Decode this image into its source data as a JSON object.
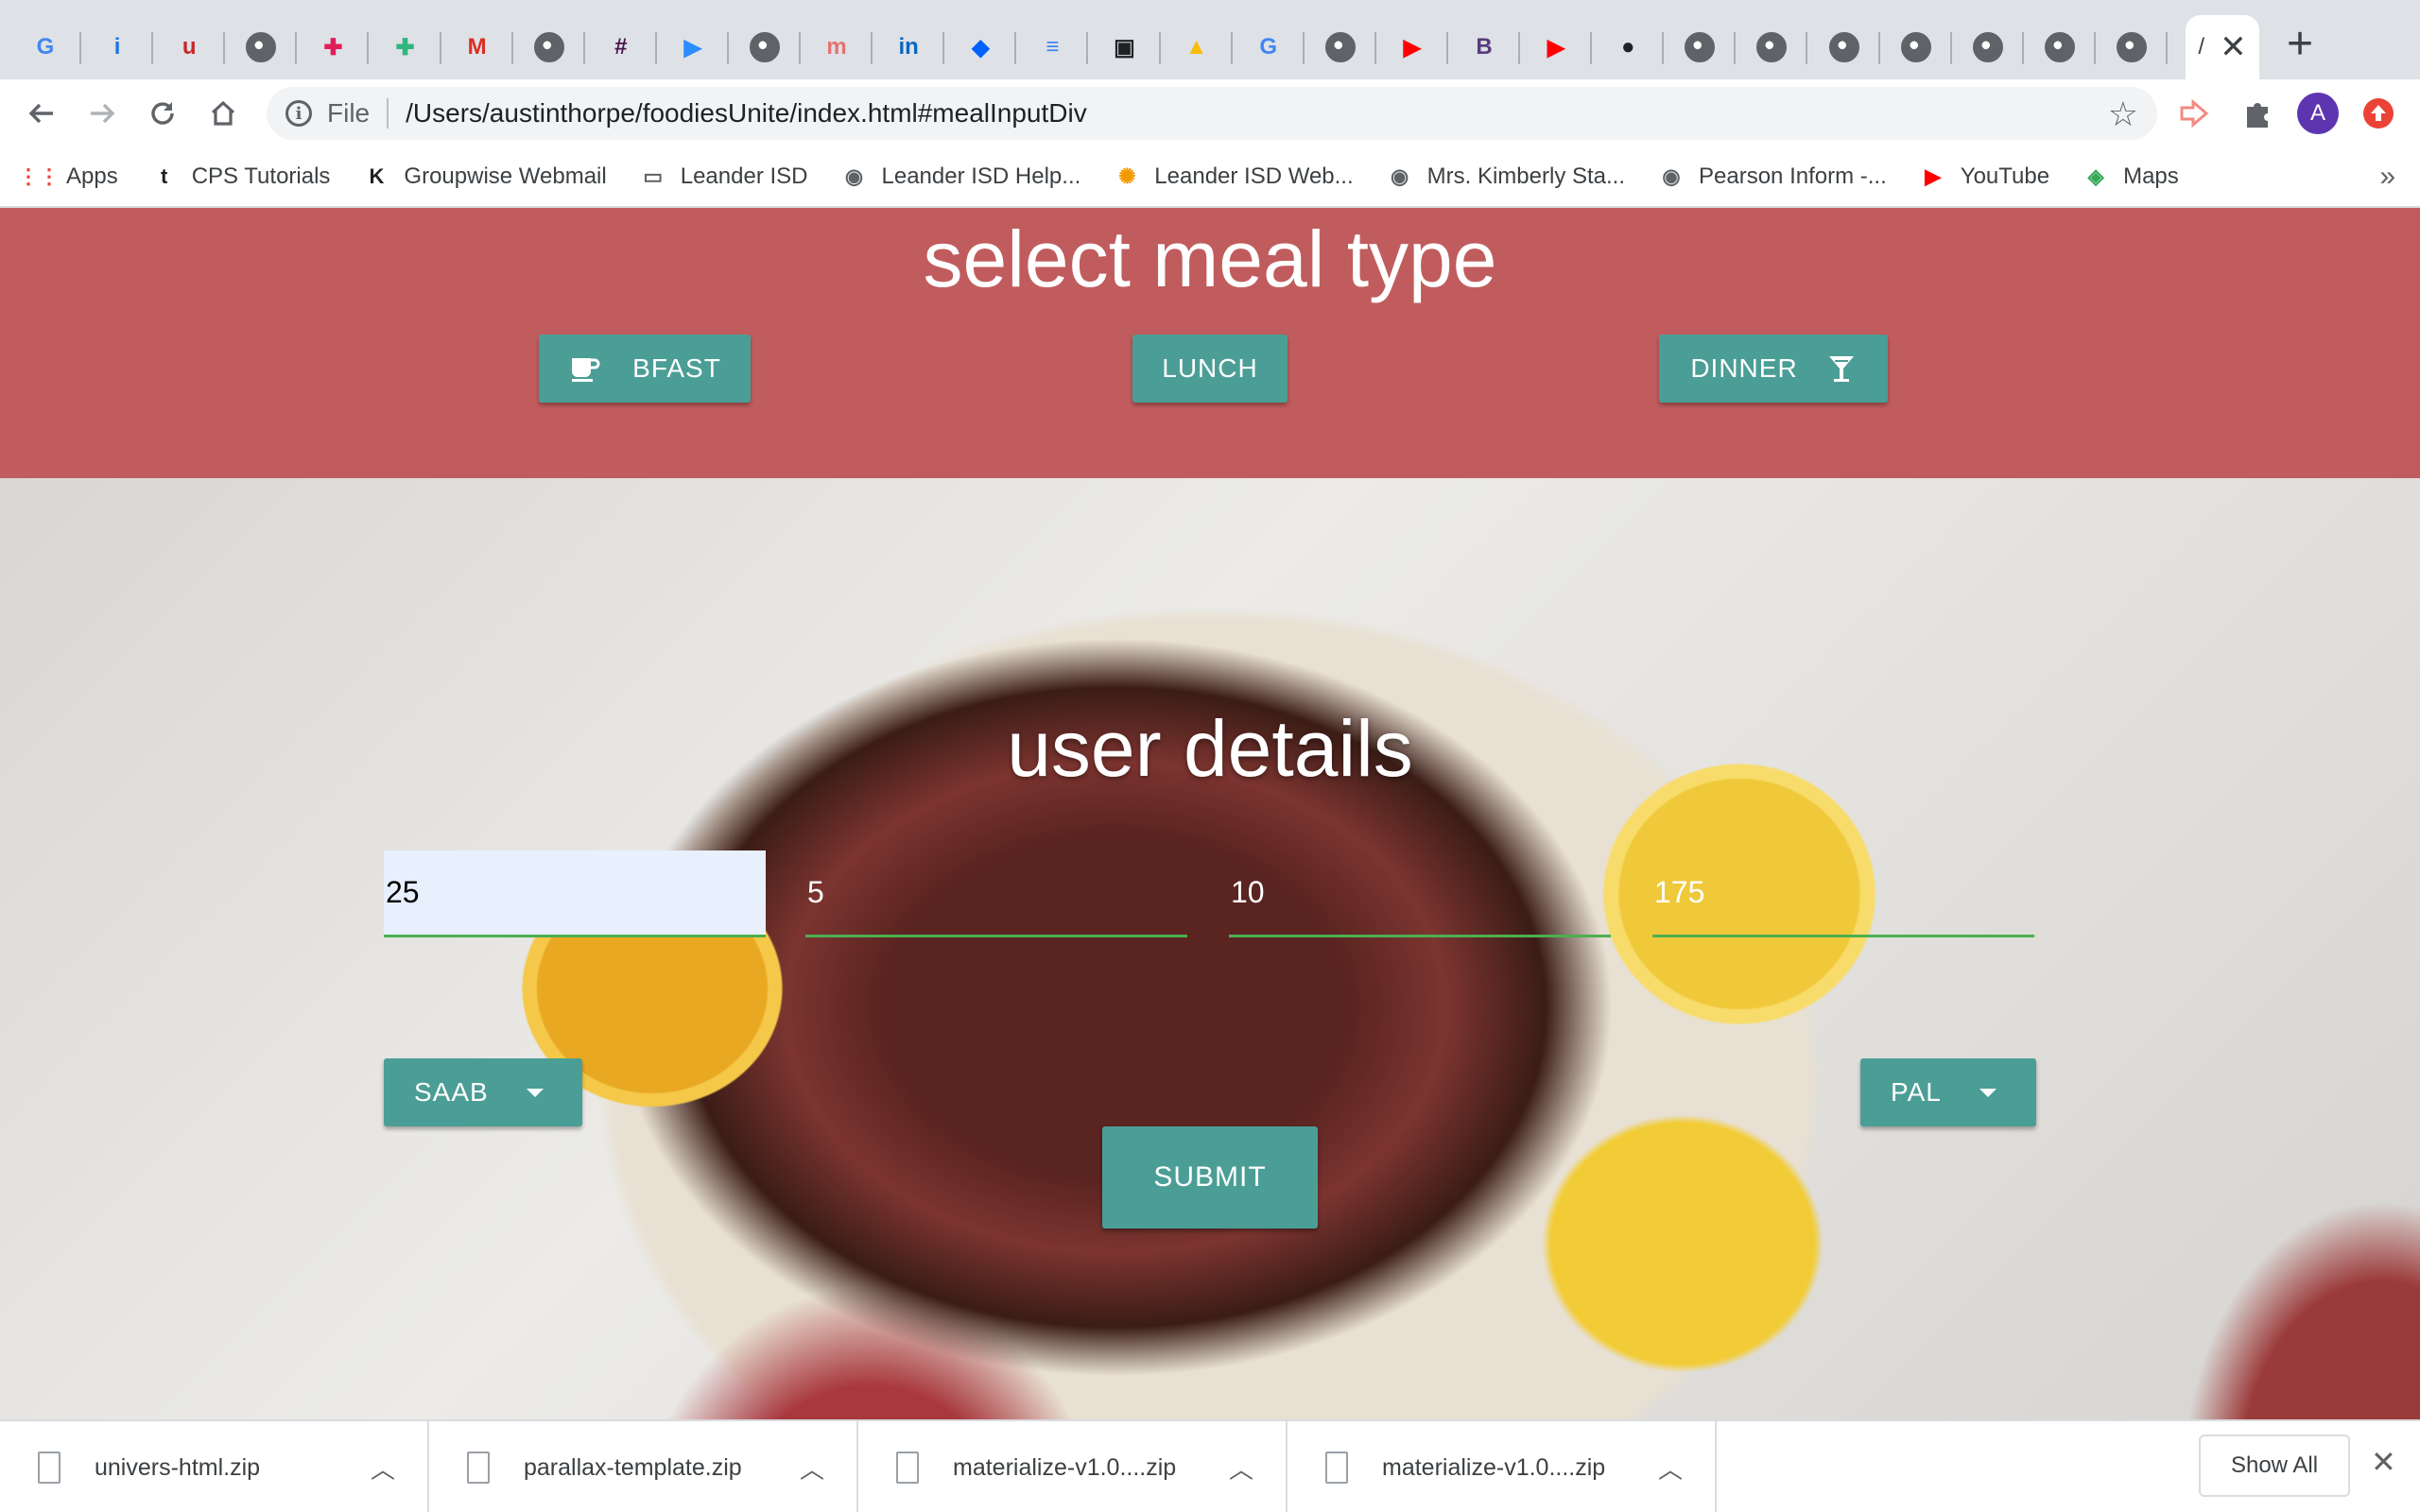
{
  "browser": {
    "tabs": [
      {
        "icon": "google-icon",
        "glyph": "G",
        "color": "#4285f4"
      },
      {
        "icon": "info-i-icon",
        "glyph": "i",
        "color": "#1a73e8"
      },
      {
        "icon": "u-logo-icon",
        "glyph": "u",
        "color": "#c62828"
      },
      {
        "icon": "globe-icon",
        "glyph": "",
        "color": "#5f6368"
      },
      {
        "icon": "slack-icon",
        "glyph": "✚",
        "color": "#e01e5a"
      },
      {
        "icon": "slack-icon",
        "glyph": "✚",
        "color": "#2eb67d"
      },
      {
        "icon": "gmail-icon",
        "glyph": "M",
        "color": "#d93025"
      },
      {
        "icon": "globe-icon",
        "glyph": "",
        "color": "#5f6368"
      },
      {
        "icon": "slack-dark-icon",
        "glyph": "#",
        "color": "#4a154b"
      },
      {
        "icon": "zoom-icon",
        "glyph": "▶",
        "color": "#2d8cff"
      },
      {
        "icon": "globe-icon",
        "glyph": "",
        "color": "#5f6368"
      },
      {
        "icon": "m-logo-icon",
        "glyph": "m",
        "color": "#e57373"
      },
      {
        "icon": "linkedin-icon",
        "glyph": "in",
        "color": "#0a66c2"
      },
      {
        "icon": "dropbox-icon",
        "glyph": "◆",
        "color": "#0061ff"
      },
      {
        "icon": "docs-icon",
        "glyph": "≡",
        "color": "#4285f4"
      },
      {
        "icon": "boxed-icon",
        "glyph": "▣",
        "color": "#202124"
      },
      {
        "icon": "drive-icon",
        "glyph": "▲",
        "color": "#fbbc04"
      },
      {
        "icon": "google-icon",
        "glyph": "G",
        "color": "#4285f4"
      },
      {
        "icon": "globe-icon",
        "glyph": "",
        "color": "#5f6368"
      },
      {
        "icon": "youtube-icon",
        "glyph": "▶",
        "color": "#ff0000"
      },
      {
        "icon": "bootstrap-icon",
        "glyph": "B",
        "color": "#563d7c"
      },
      {
        "icon": "youtube-icon",
        "glyph": "▶",
        "color": "#ff0000"
      },
      {
        "icon": "github-icon",
        "glyph": "●",
        "color": "#202124"
      },
      {
        "icon": "globe-icon",
        "glyph": "",
        "color": "#5f6368"
      },
      {
        "icon": "globe-icon",
        "glyph": "",
        "color": "#5f6368"
      },
      {
        "icon": "globe-icon",
        "glyph": "",
        "color": "#5f6368"
      },
      {
        "icon": "globe-icon",
        "glyph": "",
        "color": "#5f6368"
      },
      {
        "icon": "globe-icon",
        "glyph": "",
        "color": "#5f6368"
      },
      {
        "icon": "globe-icon",
        "glyph": "",
        "color": "#5f6368"
      },
      {
        "icon": "globe-icon",
        "glyph": "",
        "color": "#5f6368"
      }
    ],
    "active_tab_title": "/",
    "omnibox": {
      "scheme_label": "File",
      "url": "/Users/austinthorpe/foodiesUnite/index.html#mealInputDiv"
    },
    "profile_initial": "A",
    "bookmarks": [
      {
        "label": "Apps",
        "icon": "apps-grid-icon",
        "glyph": "⋮⋮",
        "color": "#ea4335"
      },
      {
        "label": "CPS Tutorials",
        "icon": "cps-icon",
        "glyph": "t",
        "color": "#202124"
      },
      {
        "label": "Groupwise Webmail",
        "icon": "groupwise-icon",
        "glyph": "K",
        "color": "#202124"
      },
      {
        "label": "Leander ISD",
        "icon": "folder-icon",
        "glyph": "▭",
        "color": "#5f6368"
      },
      {
        "label": "Leander ISD Help...",
        "icon": "globe-icon",
        "glyph": "◉",
        "color": "#5f6368"
      },
      {
        "label": "Leander ISD Web...",
        "icon": "sun-icon",
        "glyph": "✺",
        "color": "#f29900"
      },
      {
        "label": "Mrs. Kimberly Sta...",
        "icon": "globe-icon",
        "glyph": "◉",
        "color": "#5f6368"
      },
      {
        "label": "Pearson Inform -...",
        "icon": "globe-icon",
        "glyph": "◉",
        "color": "#5f6368"
      },
      {
        "label": "YouTube",
        "icon": "youtube-icon",
        "glyph": "▶",
        "color": "#ff0000"
      },
      {
        "label": "Maps",
        "icon": "maps-icon",
        "glyph": "◈",
        "color": "#34a853"
      }
    ]
  },
  "page": {
    "meal_title": "select meal type",
    "meal_buttons": {
      "breakfast": "BFAST",
      "lunch": "LUNCH",
      "dinner": "DINNER"
    },
    "details_title": "user details",
    "fields": {
      "age": "25",
      "feet": "5",
      "inches": "10",
      "weight": "175"
    },
    "sex_dropdown": "SAAB",
    "pal_dropdown": "PAL",
    "submit": "SUBMIT",
    "colors": {
      "meal_bg": "#c05c5d",
      "button": "#4b9e96",
      "underline": "#4caf50"
    }
  },
  "downloads": {
    "items": [
      "univers-html.zip",
      "parallax-template.zip",
      "materialize-v1.0....zip",
      "materialize-v1.0....zip"
    ],
    "show_all": "Show All"
  }
}
